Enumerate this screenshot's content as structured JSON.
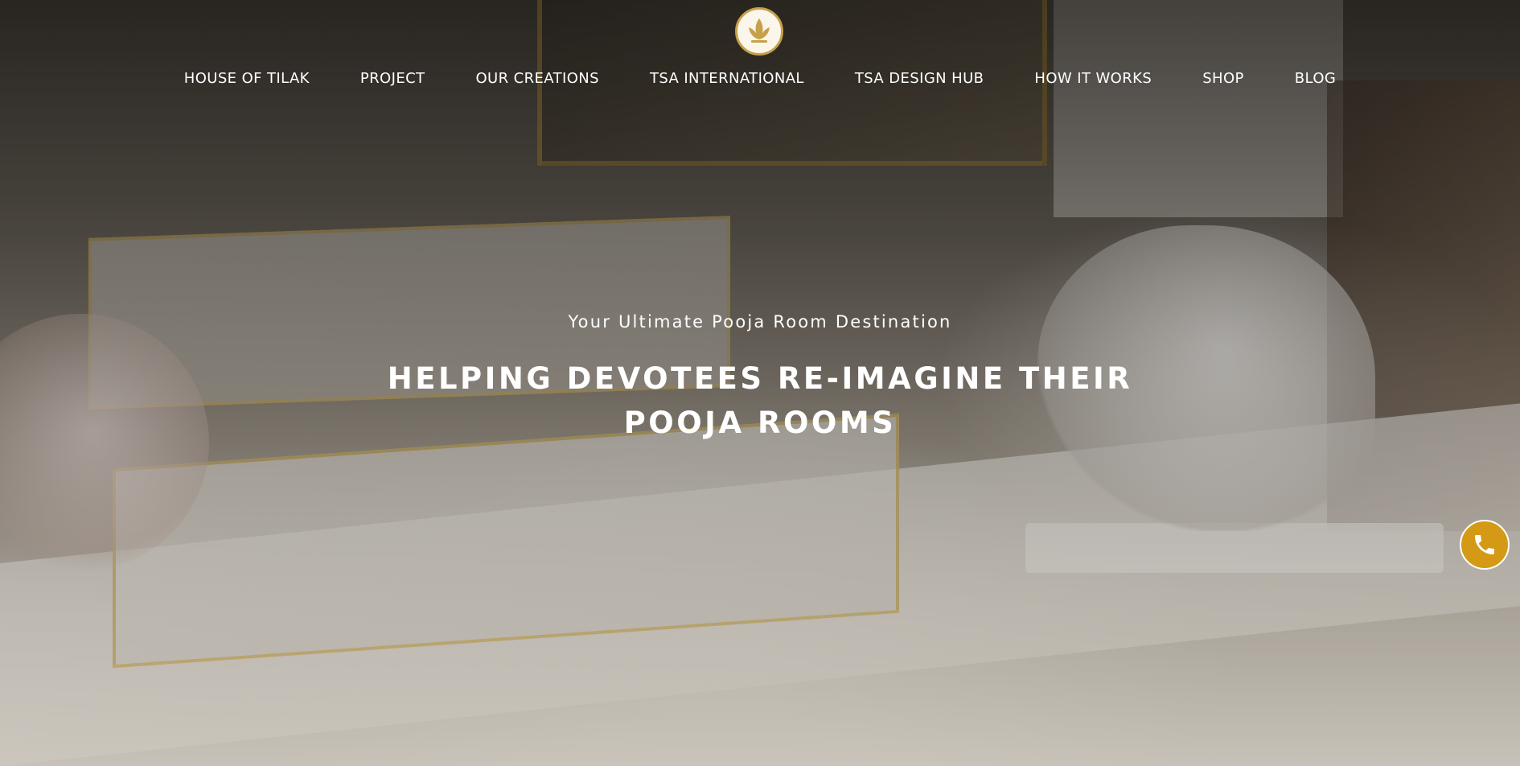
{
  "header": {
    "logo_icon": "lotus-emblem-icon",
    "nav_items": [
      {
        "label": "HOUSE OF TILAK"
      },
      {
        "label": "PROJECT"
      },
      {
        "label": "OUR CREATIONS"
      },
      {
        "label": "TSA INTERNATIONAL"
      },
      {
        "label": "TSA DESIGN HUB"
      },
      {
        "label": "HOW IT WORKS"
      },
      {
        "label": "SHOP"
      },
      {
        "label": "BLOG"
      }
    ]
  },
  "hero": {
    "subtitle": "Your Ultimate Pooja Room Destination",
    "headline_line1": "HELPING DEVOTEES RE-IMAGINE THEIR",
    "headline_line2": "POOJA ROOMS"
  },
  "floating": {
    "call_icon": "phone-icon",
    "call_color": "#d49a15"
  },
  "colors": {
    "accent_gold": "#c6a04a",
    "text": "#ffffff"
  }
}
